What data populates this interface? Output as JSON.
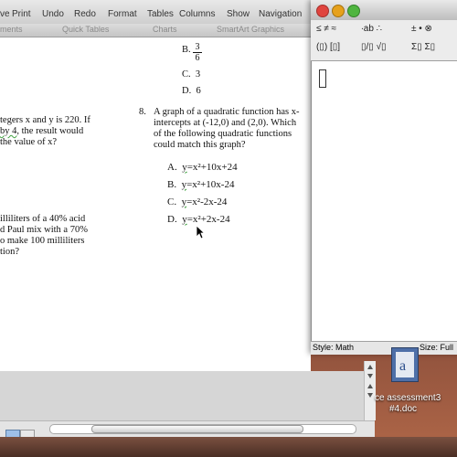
{
  "toolbar": {
    "items": [
      "ve",
      "Print",
      "Undo",
      "Redo",
      "Format",
      "Tables",
      "Columns",
      "Show",
      "Navigation"
    ]
  },
  "ribbon": {
    "items": [
      "ments",
      "Quick Tables",
      "Charts",
      "SmartArt Graphics"
    ]
  },
  "document": {
    "prev_options": [
      {
        "letter": "B.",
        "num": "3",
        "den": "6"
      },
      {
        "letter": "C.",
        "text": "3"
      },
      {
        "letter": "D.",
        "text": "6"
      }
    ],
    "left_fragments": {
      "q6_line1": "tegers x and y is 220.  If",
      "q6_line2_pre": "",
      "q6_line2_squig": "by 4",
      "q6_line2_post": ", the result would",
      "q6_line3": "the value of x?",
      "q7_line1": "illiliters of a 40% acid",
      "q7_line2": "d Paul mix with a 70%",
      "q7_line3": "o make 100 milliliters",
      "q7_line4": "tion?"
    },
    "q8": {
      "number": "8.",
      "line1": "A graph of a quadratic function has x-",
      "line2": "intercepts at (-12,0) and (2,0). Which",
      "line3": "of the following quadratic functions",
      "line4": "could match this graph?",
      "options": [
        {
          "letter": "A.",
          "y": "y",
          "rest": "=x²+10x+24"
        },
        {
          "letter": "B.",
          "y": "y",
          "rest": "=x²+10x-24"
        },
        {
          "letter": "C.",
          "y": "y",
          "rest": "=x²-2x-24"
        },
        {
          "letter": "D.",
          "y": "y",
          "rest": "=x²+2x-24"
        }
      ]
    }
  },
  "equation_editor": {
    "palette_row1": [
      "≤ ≠ ≈",
      "∙ab ∴",
      "± • ⊗"
    ],
    "palette_row2": [
      "(▯) [▯]",
      "▯/▯ √▯",
      "Σ▯ Σ▯"
    ],
    "style_label": "Style: Math",
    "size_label": "Size: Full"
  },
  "desktop": {
    "file_label_line1": "ce assessment3",
    "file_label_line2": "#4.doc"
  },
  "colors": {
    "spell_squiggle": "#3fa03f",
    "close_button": "#e0443e",
    "minimize_button": "#e6a11c",
    "zoom_button": "#4fb53f"
  }
}
